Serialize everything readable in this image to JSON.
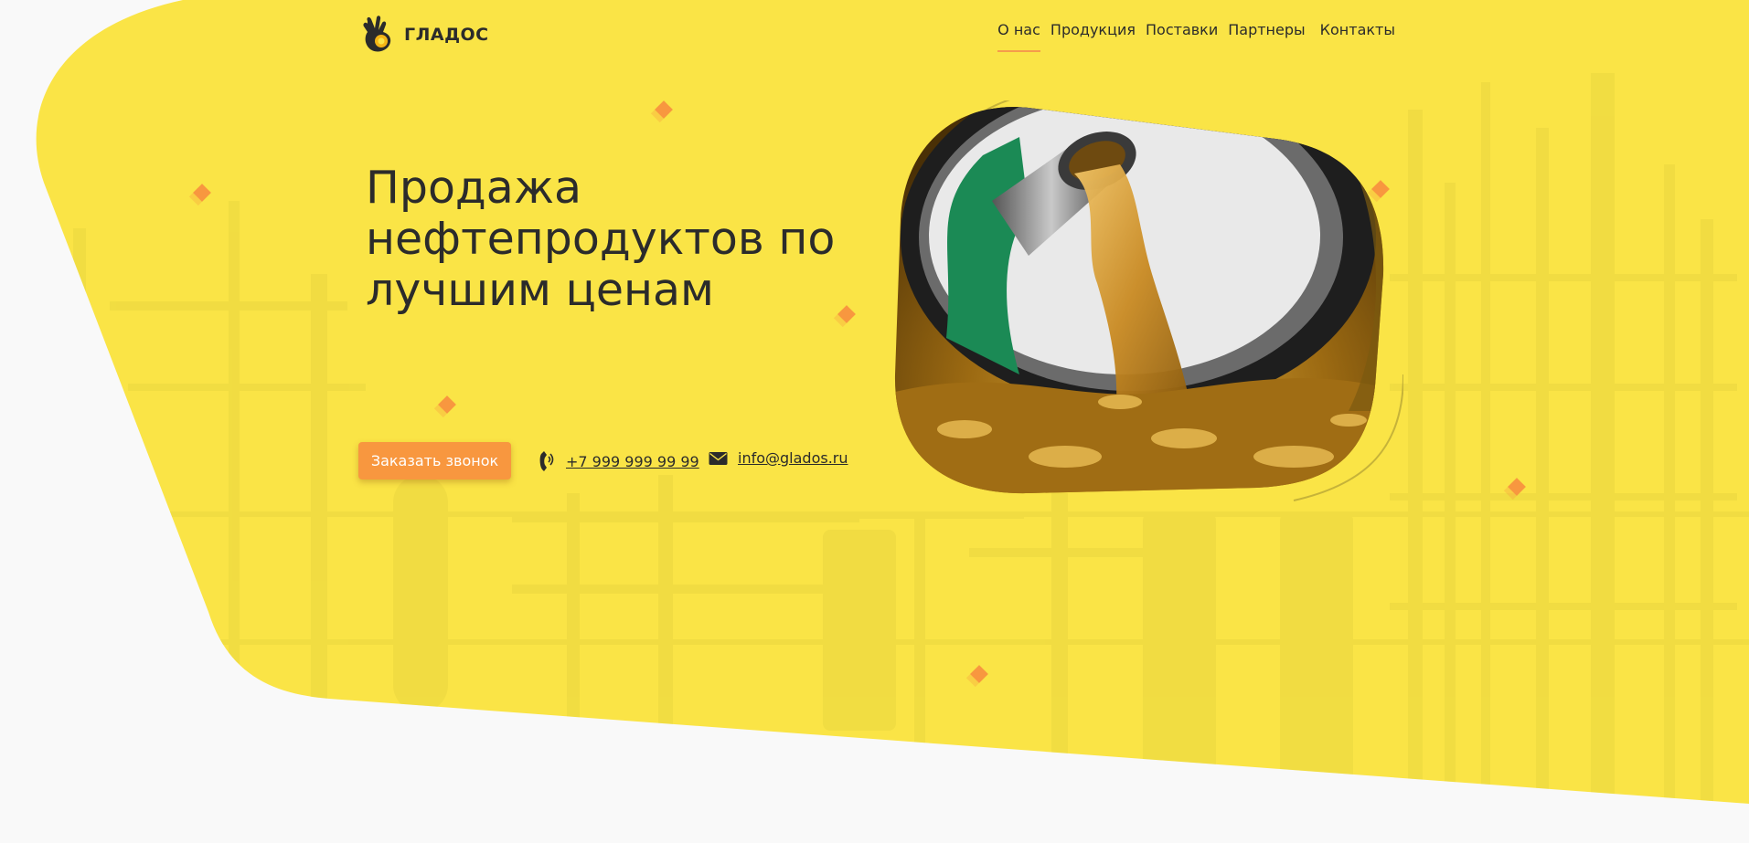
{
  "brand": {
    "name": "ГЛАДОС",
    "logo_icon": "ok-hand-icon"
  },
  "nav": {
    "items": [
      {
        "label": "О нас",
        "active": true
      },
      {
        "label": "Продукция",
        "active": false
      },
      {
        "label": "Поставки",
        "active": false
      },
      {
        "label": "Партнеры",
        "active": false
      },
      {
        "label": "Контакты",
        "active": false
      }
    ]
  },
  "hero": {
    "headline": "Продажа нефтепродуктов по лучшим ценам",
    "cta_label": "Заказать звонок",
    "phone": "+7 999 999 99 99",
    "phone_icon": "phone-icon",
    "email": "info@glados.ru",
    "email_icon": "envelope-icon",
    "image": "fuel-nozzle-pouring-oil-photo",
    "background_image": "refinery-silhouette"
  },
  "colors": {
    "accent_yellow": "#fae446",
    "accent_orange": "#f8973f",
    "page_background": "#f9f9f9",
    "text": "#2b2b2b"
  }
}
